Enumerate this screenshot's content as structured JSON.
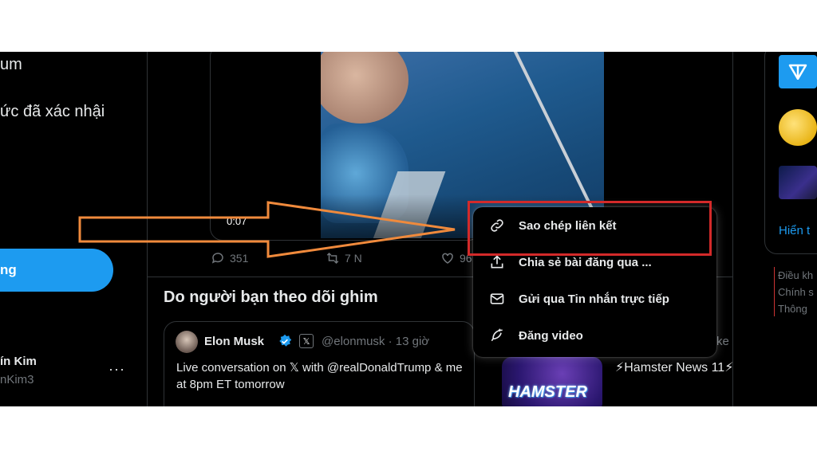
{
  "sidebar": {
    "nav_fragment_1": "um",
    "nav_fragment_2": "ức đã xác nhậi",
    "post_button": "ng",
    "account_name": "ín Kim",
    "account_handle": "nKim3",
    "more": "···"
  },
  "tweet": {
    "video_time": "0:07",
    "replies": "351",
    "reposts": "7 N",
    "likes": "96"
  },
  "pinned": {
    "title": "Do người bạn theo dõi ghim",
    "author_name": "Elon Musk",
    "author_handle": "@elonmusk · 13 giờ",
    "x_badge": "𝕏",
    "text": "Live conversation on 𝕏 with @realDonaldTrump & me at 8pm ET tomorrow"
  },
  "trend": {
    "image_label": "HAMSTER",
    "text": "⚡Hamster News 11⚡",
    "kebab": "ke"
  },
  "right_panel": {
    "show_more": "Hiển t",
    "footer": [
      "Điều kh",
      "Chính s",
      "Thông"
    ]
  },
  "context_menu": {
    "items": [
      {
        "label": "Sao chép liên kết",
        "icon": "link-icon"
      },
      {
        "label": "Chia sẻ bài đăng qua ...",
        "icon": "share-icon"
      },
      {
        "label": "Gửi qua Tin nhắn trực tiếp",
        "icon": "mail-icon"
      },
      {
        "label": "Đăng video",
        "icon": "feather-icon"
      }
    ]
  },
  "colors": {
    "accent": "#1d9bf0",
    "annotation_arrow": "#f08a3c",
    "highlight_box": "#d32a2a"
  }
}
